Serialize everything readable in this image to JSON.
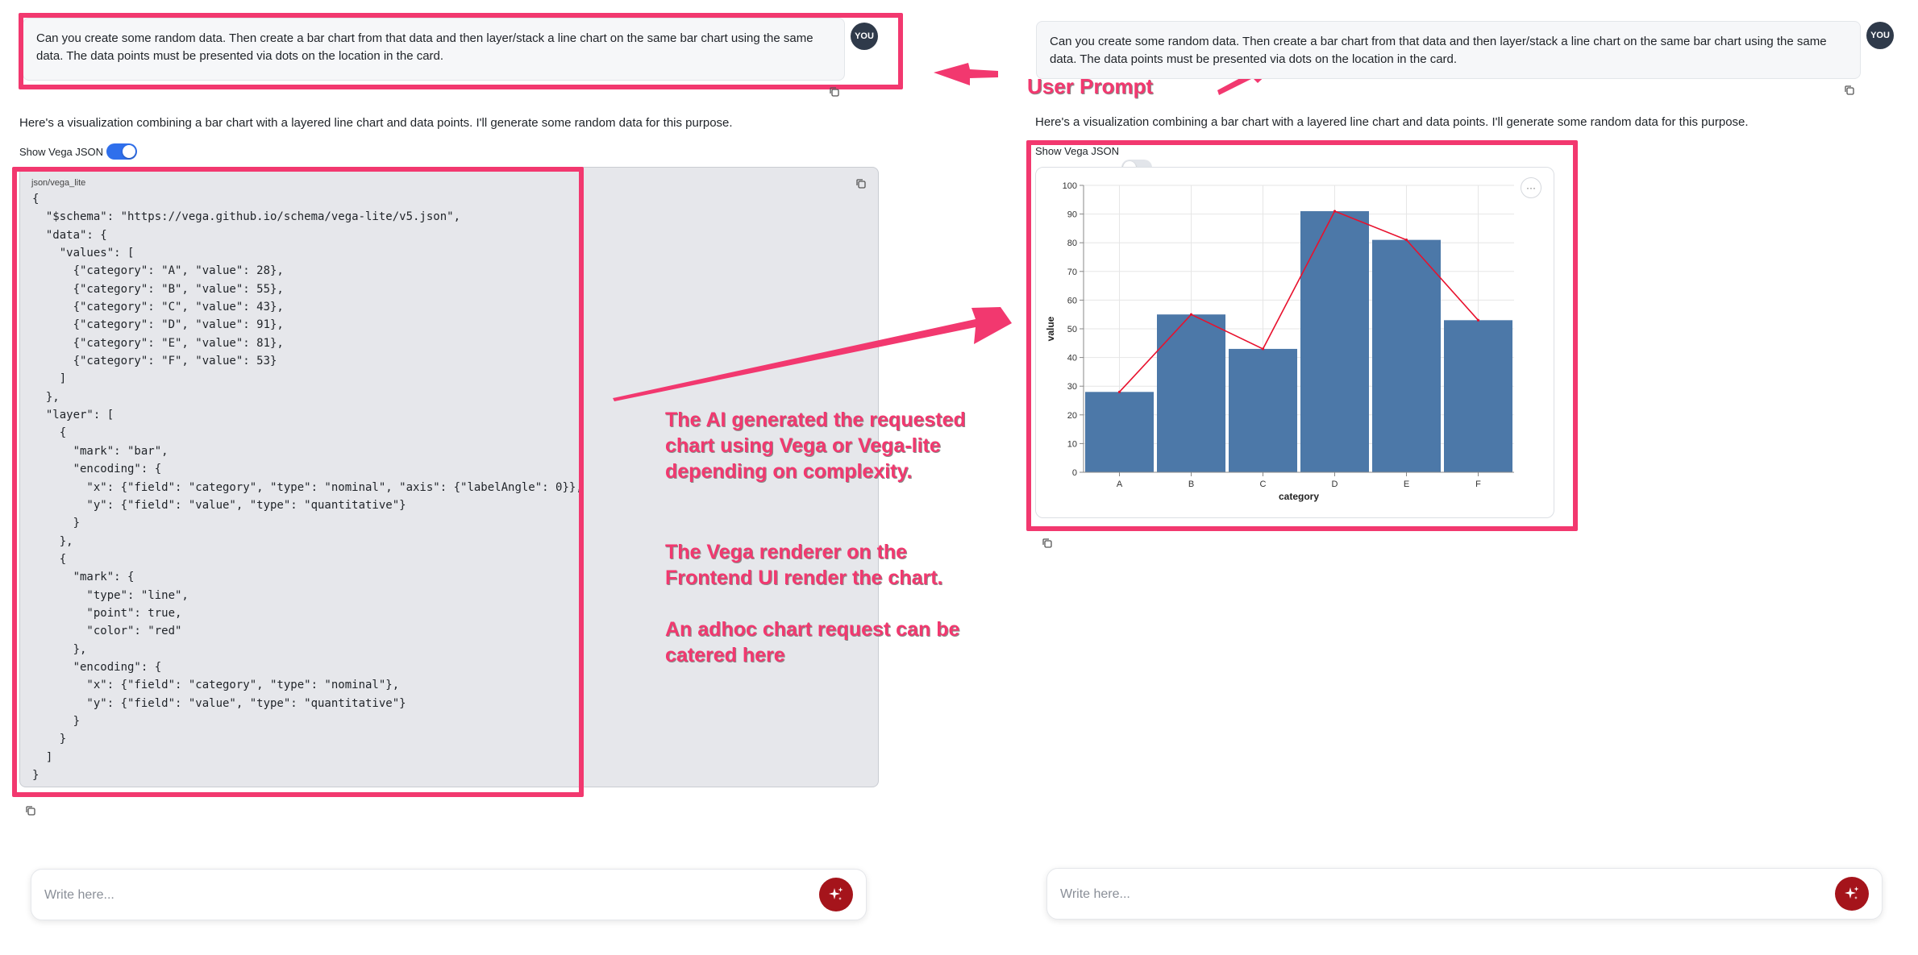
{
  "prompt": "Can you create some random data. Then create a bar chart from that data and then layer/stack a line chart on the same bar chart using the same data. The data points must be presented via dots on the location in the card.",
  "avatar_label": "YOU",
  "response": "Here's a visualization combining a bar chart with a layered line chart and data points. I'll generate some random data for this purpose.",
  "toggle_label": "Show Vega JSON",
  "left_toggle_on": true,
  "right_toggle_on": false,
  "code_language": "json/vega_lite",
  "code": "{\n  \"$schema\": \"https://vega.github.io/schema/vega-lite/v5.json\",\n  \"data\": {\n    \"values\": [\n      {\"category\": \"A\", \"value\": 28},\n      {\"category\": \"B\", \"value\": 55},\n      {\"category\": \"C\", \"value\": 43},\n      {\"category\": \"D\", \"value\": 91},\n      {\"category\": \"E\", \"value\": 81},\n      {\"category\": \"F\", \"value\": 53}\n    ]\n  },\n  \"layer\": [\n    {\n      \"mark\": \"bar\",\n      \"encoding\": {\n        \"x\": {\"field\": \"category\", \"type\": \"nominal\", \"axis\": {\"labelAngle\": 0}},\n        \"y\": {\"field\": \"value\", \"type\": \"quantitative\"}\n      }\n    },\n    {\n      \"mark\": {\n        \"type\": \"line\",\n        \"point\": true,\n        \"color\": \"red\"\n      },\n      \"encoding\": {\n        \"x\": {\"field\": \"category\", \"type\": \"nominal\"},\n        \"y\": {\"field\": \"value\", \"type\": \"quantitative\"}\n      }\n    }\n  ]\n}",
  "annotations": {
    "user_prompt": "User Prompt",
    "ai_generated": "The AI generated the requested chart using Vega or Vega-lite depending on complexity.",
    "renderer": "The Vega renderer on the Frontend UI render the chart.",
    "adhoc": "An adhoc chart request can be catered here"
  },
  "input_placeholder": "Write here...",
  "colors": {
    "accent": "#f2386f",
    "bar": "#4c78a8",
    "line": "#e8112d",
    "send": "#a5141b",
    "toggle_on": "#2f6fec"
  },
  "chart_menu_label": "···",
  "chart_data": {
    "type": "bar",
    "categories": [
      "A",
      "B",
      "C",
      "D",
      "E",
      "F"
    ],
    "values": [
      28,
      55,
      43,
      91,
      81,
      53
    ],
    "overlay": {
      "type": "line",
      "color": "#e8112d",
      "values": [
        28,
        55,
        43,
        91,
        81,
        53
      ]
    },
    "xlabel": "category",
    "ylabel": "value",
    "ylim": [
      0,
      100
    ],
    "yticks": [
      0,
      10,
      20,
      30,
      40,
      50,
      60,
      70,
      80,
      90,
      100
    ],
    "grid": true
  }
}
